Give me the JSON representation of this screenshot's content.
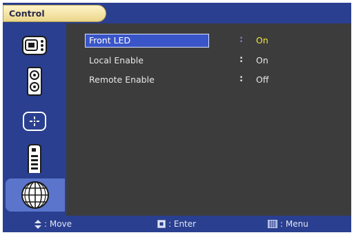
{
  "title": "Control",
  "sidebar": {
    "items": [
      {
        "icon": "picture-icon",
        "selected": false
      },
      {
        "icon": "speaker-icon",
        "selected": false
      },
      {
        "icon": "setup-icon",
        "selected": false
      },
      {
        "icon": "remote-icon",
        "selected": false
      },
      {
        "icon": "control-globe-icon",
        "selected": true
      }
    ]
  },
  "menu": {
    "rows": [
      {
        "label": "Front LED",
        "separator": ":",
        "value": "On",
        "active": true
      },
      {
        "label": "Local Enable",
        "separator": ":",
        "value": "On",
        "active": false
      },
      {
        "label": "Remote Enable",
        "separator": ":",
        "value": "Off",
        "active": false
      }
    ]
  },
  "footer": {
    "move_label": ": Move",
    "enter_label": ": Enter",
    "menu_label": ": Menu"
  },
  "colors": {
    "bar": "#2a3f8f",
    "panel": "#3c3c3c",
    "highlight": "#3a55c8",
    "value_active": "#f5ea3a",
    "tab_pill": "#f3e3a4"
  }
}
